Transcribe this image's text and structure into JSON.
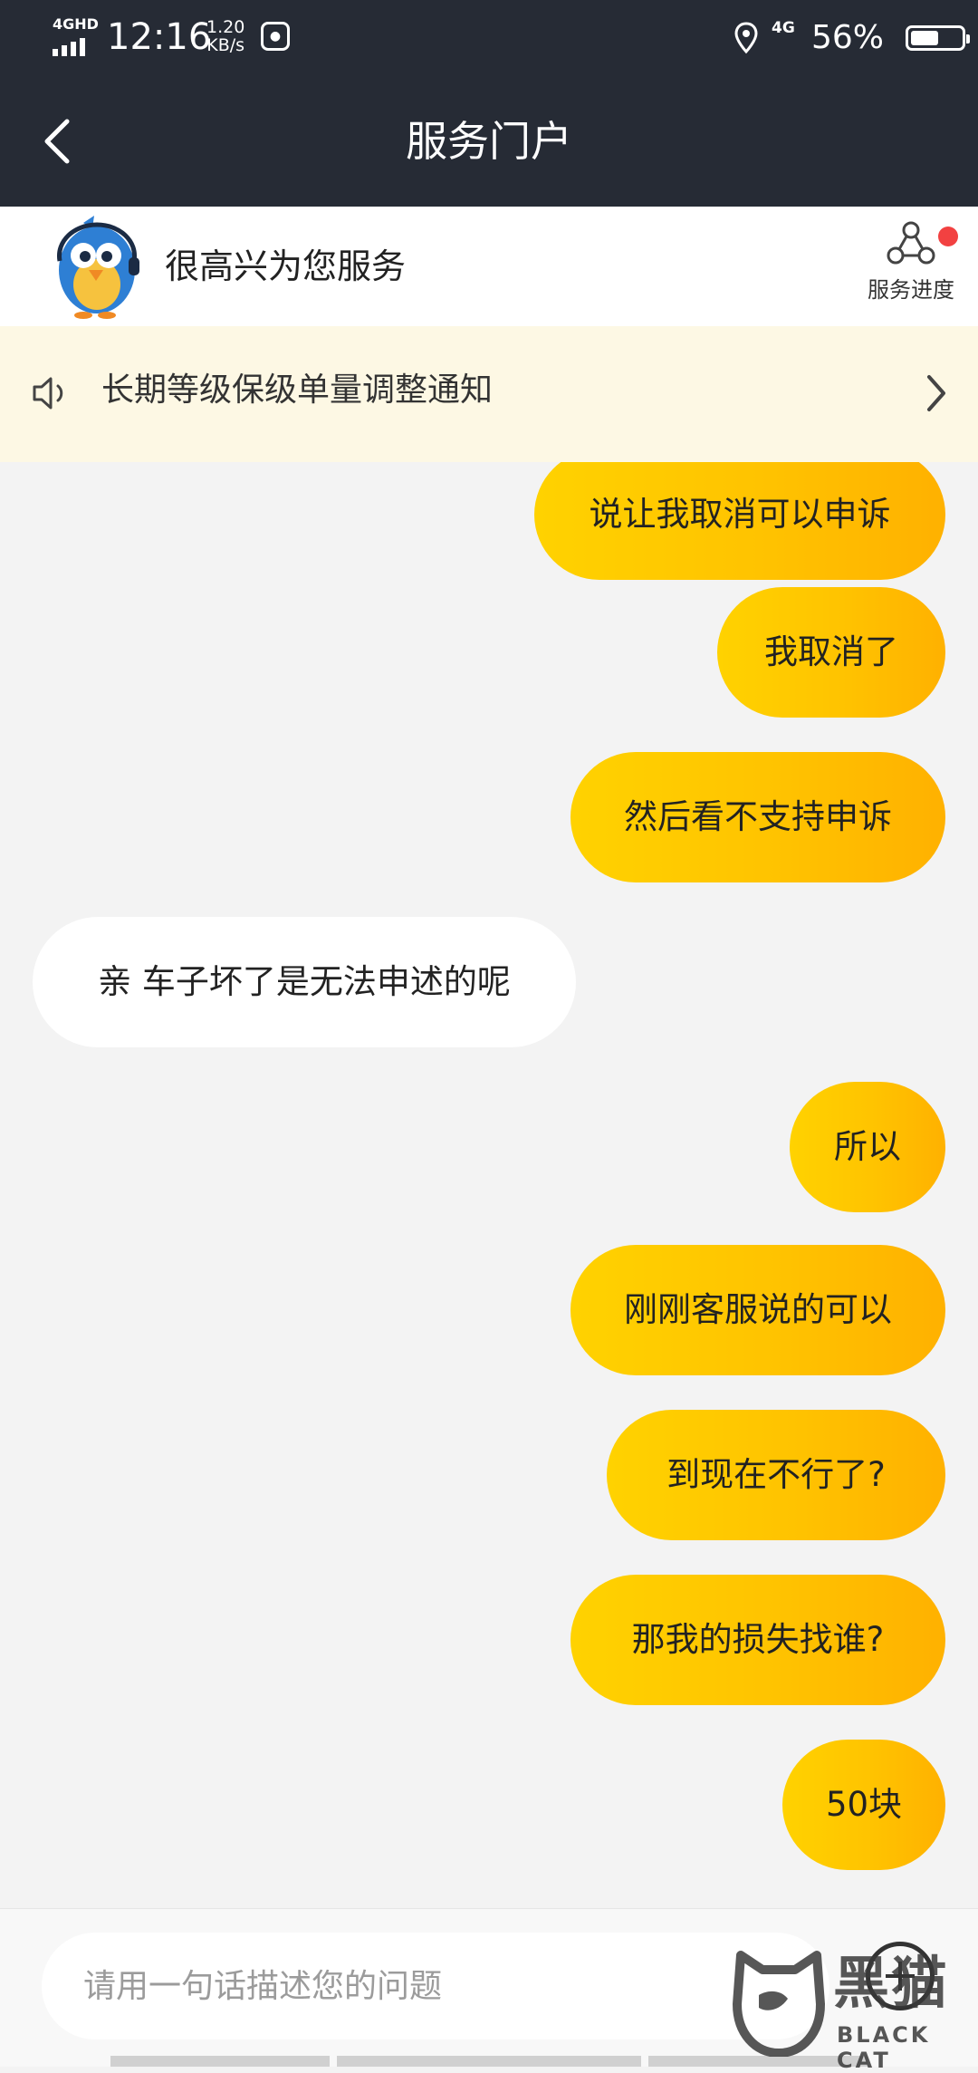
{
  "status_bar": {
    "network_label": "4GHD",
    "time": "12:16",
    "speed_value": "1.20",
    "speed_unit": "KB/s",
    "mobile_data": "4G",
    "battery_percent": "56%",
    "battery_level": 0.56
  },
  "nav": {
    "title": "服务门户",
    "back_icon": "chevron-left-icon"
  },
  "service": {
    "greeting": "很高兴为您服务",
    "progress_label": "服务进度",
    "progress_icon": "network-nodes-icon",
    "has_notification": true
  },
  "notice": {
    "text": "长期等级保级单量调整通知",
    "icon": "speaker-icon"
  },
  "messages": [
    {
      "sender": "me",
      "text": "说让我取消可以申诉"
    },
    {
      "sender": "me",
      "text": "我取消了"
    },
    {
      "sender": "me",
      "text": "然后看不支持申诉"
    },
    {
      "sender": "them",
      "text": "亲 车子坏了是无法申述的呢"
    },
    {
      "sender": "me",
      "text": "所以"
    },
    {
      "sender": "me",
      "text": "刚刚客服说的可以"
    },
    {
      "sender": "me",
      "text": "到现在不行了?"
    },
    {
      "sender": "me",
      "text": "那我的损失找谁?"
    },
    {
      "sender": "me",
      "text": "50块"
    }
  ],
  "composer": {
    "placeholder": "请用一句话描述您的问题"
  },
  "watermark": {
    "brand_cn": "黑猫",
    "brand_en": "BLACK CAT"
  },
  "colors": {
    "header_bg": "#262b35",
    "bubble_me": "#ffc300",
    "bubble_them": "#ffffff",
    "notice_bg": "#fdf8e4",
    "badge": "#f24141"
  }
}
